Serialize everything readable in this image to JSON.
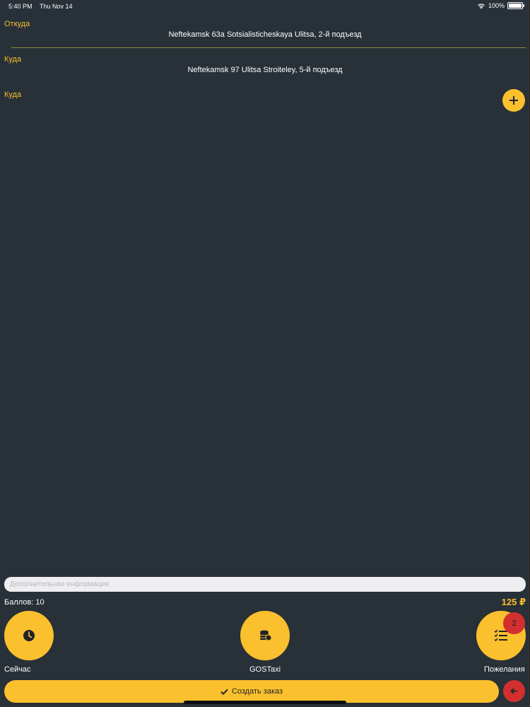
{
  "status_bar": {
    "time": "5:40 PM",
    "date": "Thu Nov 14",
    "battery": "100%"
  },
  "route": {
    "from_label": "Откуда",
    "from_address": "Neftekamsk 63a Sotsialisticheskaya Ulitsa, 2-й подъезд",
    "to_label": "Куда",
    "to_address": "Neftekamsk 97 Ulitsa Stroiteley, 5-й подъезд",
    "extra_to_label": "Куда"
  },
  "order": {
    "extra_info_placeholder": "Дополнительная информация",
    "bonus_text": "Баллов: 10",
    "price": "125 ₽",
    "time_caption": "Сейчас",
    "tariff_caption": "GOSTaxi",
    "wishes_caption": "Пожелания",
    "wishes_badge": "2",
    "create_order_label": "Создать заказ"
  },
  "icons": {
    "add_stop": "plus-icon",
    "time": "clock-icon",
    "tariff": "coins-icon",
    "wishes": "checklist-icon",
    "create_order": "check-icon",
    "back": "arrow-left-icon"
  },
  "colors": {
    "background": "#283038",
    "accent": "#fbc02d",
    "label": "#f7c02c",
    "danger": "#d32f2f"
  }
}
